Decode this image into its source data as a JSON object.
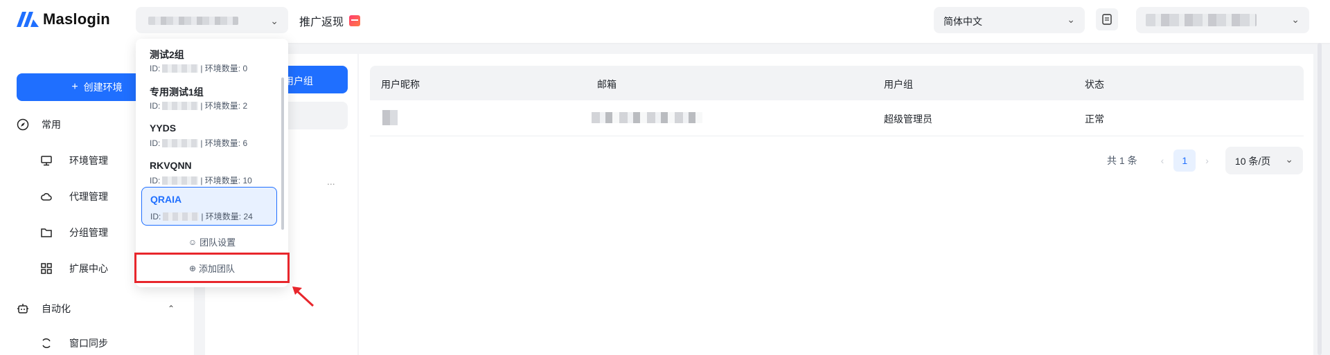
{
  "header": {
    "logo_text": "Maslogin",
    "promo_label": "推广返现",
    "language": "简体中文"
  },
  "sidebar": {
    "create_button": "创建环境",
    "groups": [
      {
        "label": "常用",
        "icon": "compass-icon"
      },
      {
        "label": "自动化",
        "icon": "robot-icon"
      }
    ],
    "items": [
      {
        "label": "环境管理",
        "icon": "monitor-icon"
      },
      {
        "label": "代理管理",
        "icon": "cloud-icon"
      },
      {
        "label": "分组管理",
        "icon": "folder-icon"
      },
      {
        "label": "扩展中心",
        "icon": "grid-icon"
      },
      {
        "label": "窗口同步",
        "icon": "sync-icon"
      }
    ]
  },
  "group_panel": {
    "active_label": "用户组",
    "more_label": "..."
  },
  "table": {
    "columns": [
      "用户昵称",
      "邮箱",
      "用户组",
      "状态"
    ],
    "rows": [
      {
        "group": "超级管理员",
        "status": "正常"
      }
    ]
  },
  "pagination": {
    "total": "共 1 条",
    "current_page": "1",
    "page_size": "10 条/页"
  },
  "team_dropdown": {
    "teams": [
      {
        "name": "测试2组",
        "id_prefix": "ID:",
        "env_label": "| 环境数量: 0"
      },
      {
        "name": "专用测试1组",
        "id_prefix": "ID:",
        "env_label": "| 环境数量: 2"
      },
      {
        "name": "YYDS",
        "id_prefix": "ID:",
        "env_label": "| 环境数量: 6"
      },
      {
        "name": "RKVQNN",
        "id_prefix": "ID:",
        "env_label": "| 环境数量: 10"
      },
      {
        "name": "QRAIA",
        "id_prefix": "ID:",
        "env_label": "| 环境数量: 24"
      }
    ],
    "settings_label": "团队设置",
    "add_label": "添加团队"
  },
  "colors": {
    "primary": "#1f6fff",
    "highlight": "#e8262c"
  }
}
